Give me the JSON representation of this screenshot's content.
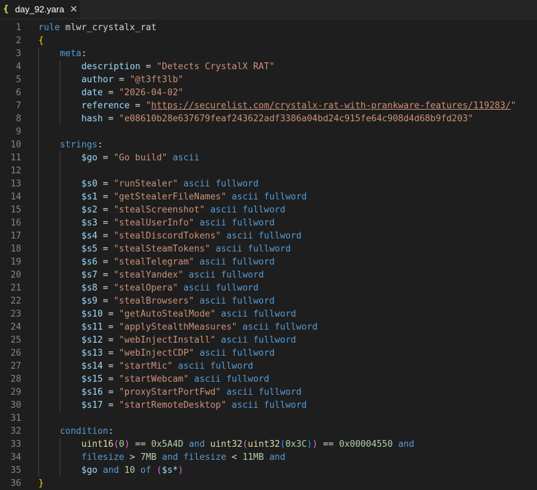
{
  "tab": {
    "icon": "{",
    "title": "day_92.yara",
    "close": "✕"
  },
  "colors": {
    "editor_bg": "#1e1e1e",
    "keyword": "#569cd6",
    "string": "#ce9178",
    "number": "#b5cea8",
    "identifier": "#9cdcfe",
    "function": "#dcdcaa",
    "line_number": "#858585"
  },
  "lines": [
    [
      [
        "kw",
        "rule"
      ],
      [
        "plain",
        " mlwr_crystalx_rat"
      ]
    ],
    [
      [
        "brace",
        "{"
      ]
    ],
    [
      [
        "plain",
        "    "
      ],
      [
        "kw",
        "meta"
      ],
      [
        "plain",
        ":"
      ]
    ],
    [
      [
        "plain",
        "        "
      ],
      [
        "meta",
        "description"
      ],
      [
        "plain",
        " = "
      ],
      [
        "str",
        "\"Detects CrystalX RAT\""
      ]
    ],
    [
      [
        "plain",
        "        "
      ],
      [
        "meta",
        "author"
      ],
      [
        "plain",
        " = "
      ],
      [
        "str",
        "\"@t3ft3lb\""
      ]
    ],
    [
      [
        "plain",
        "        "
      ],
      [
        "meta",
        "date"
      ],
      [
        "plain",
        " = "
      ],
      [
        "str",
        "\"2026-04-02\""
      ]
    ],
    [
      [
        "plain",
        "        "
      ],
      [
        "meta",
        "reference"
      ],
      [
        "plain",
        " = "
      ],
      [
        "str",
        "\""
      ],
      [
        "link",
        "https://securelist.com/crystalx-rat-with-prankware-features/119283/"
      ],
      [
        "str",
        "\""
      ]
    ],
    [
      [
        "plain",
        "        "
      ],
      [
        "meta",
        "hash"
      ],
      [
        "plain",
        " = "
      ],
      [
        "str",
        "\"e08610b28e637679feaf243622adf3386a04bd24c915fe64c908d4d68b9fd203\""
      ]
    ],
    [],
    [
      [
        "plain",
        "    "
      ],
      [
        "kw",
        "strings"
      ],
      [
        "plain",
        ":"
      ]
    ],
    [
      [
        "plain",
        "        "
      ],
      [
        "meta",
        "$go"
      ],
      [
        "plain",
        " = "
      ],
      [
        "str",
        "\"Go build\""
      ],
      [
        "plain",
        " "
      ],
      [
        "kw",
        "ascii"
      ]
    ],
    [],
    [
      [
        "plain",
        "        "
      ],
      [
        "meta",
        "$s0"
      ],
      [
        "plain",
        " = "
      ],
      [
        "str",
        "\"runStealer\""
      ],
      [
        "plain",
        " "
      ],
      [
        "kw",
        "ascii"
      ],
      [
        "plain",
        " "
      ],
      [
        "kw",
        "fullword"
      ]
    ],
    [
      [
        "plain",
        "        "
      ],
      [
        "meta",
        "$s1"
      ],
      [
        "plain",
        " = "
      ],
      [
        "str",
        "\"getStealerFileNames\""
      ],
      [
        "plain",
        " "
      ],
      [
        "kw",
        "ascii"
      ],
      [
        "plain",
        " "
      ],
      [
        "kw",
        "fullword"
      ]
    ],
    [
      [
        "plain",
        "        "
      ],
      [
        "meta",
        "$s2"
      ],
      [
        "plain",
        " = "
      ],
      [
        "str",
        "\"stealScreenshot\""
      ],
      [
        "plain",
        " "
      ],
      [
        "kw",
        "ascii"
      ],
      [
        "plain",
        " "
      ],
      [
        "kw",
        "fullword"
      ]
    ],
    [
      [
        "plain",
        "        "
      ],
      [
        "meta",
        "$s3"
      ],
      [
        "plain",
        " = "
      ],
      [
        "str",
        "\"stealUserInfo\""
      ],
      [
        "plain",
        " "
      ],
      [
        "kw",
        "ascii"
      ],
      [
        "plain",
        " "
      ],
      [
        "kw",
        "fullword"
      ]
    ],
    [
      [
        "plain",
        "        "
      ],
      [
        "meta",
        "$s4"
      ],
      [
        "plain",
        " = "
      ],
      [
        "str",
        "\"stealDiscordTokens\""
      ],
      [
        "plain",
        " "
      ],
      [
        "kw",
        "ascii"
      ],
      [
        "plain",
        " "
      ],
      [
        "kw",
        "fullword"
      ]
    ],
    [
      [
        "plain",
        "        "
      ],
      [
        "meta",
        "$s5"
      ],
      [
        "plain",
        " = "
      ],
      [
        "str",
        "\"stealSteamTokens\""
      ],
      [
        "plain",
        " "
      ],
      [
        "kw",
        "ascii"
      ],
      [
        "plain",
        " "
      ],
      [
        "kw",
        "fullword"
      ]
    ],
    [
      [
        "plain",
        "        "
      ],
      [
        "meta",
        "$s6"
      ],
      [
        "plain",
        " = "
      ],
      [
        "str",
        "\"stealTelegram\""
      ],
      [
        "plain",
        " "
      ],
      [
        "kw",
        "ascii"
      ],
      [
        "plain",
        " "
      ],
      [
        "kw",
        "fullword"
      ]
    ],
    [
      [
        "plain",
        "        "
      ],
      [
        "meta",
        "$s7"
      ],
      [
        "plain",
        " = "
      ],
      [
        "str",
        "\"stealYandex\""
      ],
      [
        "plain",
        " "
      ],
      [
        "kw",
        "ascii"
      ],
      [
        "plain",
        " "
      ],
      [
        "kw",
        "fullword"
      ]
    ],
    [
      [
        "plain",
        "        "
      ],
      [
        "meta",
        "$s8"
      ],
      [
        "plain",
        " = "
      ],
      [
        "str",
        "\"stealOpera\""
      ],
      [
        "plain",
        " "
      ],
      [
        "kw",
        "ascii"
      ],
      [
        "plain",
        " "
      ],
      [
        "kw",
        "fullword"
      ]
    ],
    [
      [
        "plain",
        "        "
      ],
      [
        "meta",
        "$s9"
      ],
      [
        "plain",
        " = "
      ],
      [
        "str",
        "\"stealBrowsers\""
      ],
      [
        "plain",
        " "
      ],
      [
        "kw",
        "ascii"
      ],
      [
        "plain",
        " "
      ],
      [
        "kw",
        "fullword"
      ]
    ],
    [
      [
        "plain",
        "        "
      ],
      [
        "meta",
        "$s10"
      ],
      [
        "plain",
        " = "
      ],
      [
        "str",
        "\"getAutoStealMode\""
      ],
      [
        "plain",
        " "
      ],
      [
        "kw",
        "ascii"
      ],
      [
        "plain",
        " "
      ],
      [
        "kw",
        "fullword"
      ]
    ],
    [
      [
        "plain",
        "        "
      ],
      [
        "meta",
        "$s11"
      ],
      [
        "plain",
        " = "
      ],
      [
        "str",
        "\"applyStealthMeasures\""
      ],
      [
        "plain",
        " "
      ],
      [
        "kw",
        "ascii"
      ],
      [
        "plain",
        " "
      ],
      [
        "kw",
        "fullword"
      ]
    ],
    [
      [
        "plain",
        "        "
      ],
      [
        "meta",
        "$s12"
      ],
      [
        "plain",
        " = "
      ],
      [
        "str",
        "\"webInjectInstall\""
      ],
      [
        "plain",
        " "
      ],
      [
        "kw",
        "ascii"
      ],
      [
        "plain",
        " "
      ],
      [
        "kw",
        "fullword"
      ]
    ],
    [
      [
        "plain",
        "        "
      ],
      [
        "meta",
        "$s13"
      ],
      [
        "plain",
        " = "
      ],
      [
        "str",
        "\"webInjectCDP\""
      ],
      [
        "plain",
        " "
      ],
      [
        "kw",
        "ascii"
      ],
      [
        "plain",
        " "
      ],
      [
        "kw",
        "fullword"
      ]
    ],
    [
      [
        "plain",
        "        "
      ],
      [
        "meta",
        "$s14"
      ],
      [
        "plain",
        " = "
      ],
      [
        "str",
        "\"startMic\""
      ],
      [
        "plain",
        " "
      ],
      [
        "kw",
        "ascii"
      ],
      [
        "plain",
        " "
      ],
      [
        "kw",
        "fullword"
      ]
    ],
    [
      [
        "plain",
        "        "
      ],
      [
        "meta",
        "$s15"
      ],
      [
        "plain",
        " = "
      ],
      [
        "str",
        "\"startWebcam\""
      ],
      [
        "plain",
        " "
      ],
      [
        "kw",
        "ascii"
      ],
      [
        "plain",
        " "
      ],
      [
        "kw",
        "fullword"
      ]
    ],
    [
      [
        "plain",
        "        "
      ],
      [
        "meta",
        "$s16"
      ],
      [
        "plain",
        " = "
      ],
      [
        "str",
        "\"proxyStartPortFwd\""
      ],
      [
        "plain",
        " "
      ],
      [
        "kw",
        "ascii"
      ],
      [
        "plain",
        " "
      ],
      [
        "kw",
        "fullword"
      ]
    ],
    [
      [
        "plain",
        "        "
      ],
      [
        "meta",
        "$s17"
      ],
      [
        "plain",
        " = "
      ],
      [
        "str",
        "\"startRemoteDesktop\""
      ],
      [
        "plain",
        " "
      ],
      [
        "kw",
        "ascii"
      ],
      [
        "plain",
        " "
      ],
      [
        "kw",
        "fullword"
      ]
    ],
    [],
    [
      [
        "plain",
        "    "
      ],
      [
        "kw",
        "condition"
      ],
      [
        "plain",
        ":"
      ]
    ],
    [
      [
        "plain",
        "        "
      ],
      [
        "fn",
        "uint16"
      ],
      [
        "paren",
        "("
      ],
      [
        "num",
        "0"
      ],
      [
        "paren",
        ")"
      ],
      [
        "plain",
        " == "
      ],
      [
        "num",
        "0x5A4D"
      ],
      [
        "plain",
        " "
      ],
      [
        "kw",
        "and"
      ],
      [
        "plain",
        " "
      ],
      [
        "fn",
        "uint32"
      ],
      [
        "paren",
        "("
      ],
      [
        "fn",
        "uint32"
      ],
      [
        "paren2",
        "("
      ],
      [
        "num",
        "0x3C"
      ],
      [
        "paren2",
        ")"
      ],
      [
        "paren",
        ")"
      ],
      [
        "plain",
        " == "
      ],
      [
        "num",
        "0x00004550"
      ],
      [
        "plain",
        " "
      ],
      [
        "kw",
        "and"
      ]
    ],
    [
      [
        "plain",
        "        "
      ],
      [
        "kw",
        "filesize"
      ],
      [
        "plain",
        " > "
      ],
      [
        "num",
        "7MB"
      ],
      [
        "plain",
        " "
      ],
      [
        "kw",
        "and"
      ],
      [
        "plain",
        " "
      ],
      [
        "kw",
        "filesize"
      ],
      [
        "plain",
        " < "
      ],
      [
        "num",
        "11MB"
      ],
      [
        "plain",
        " "
      ],
      [
        "kw",
        "and"
      ]
    ],
    [
      [
        "plain",
        "        "
      ],
      [
        "meta",
        "$go"
      ],
      [
        "plain",
        " "
      ],
      [
        "kw",
        "and"
      ],
      [
        "plain",
        " "
      ],
      [
        "num",
        "10"
      ],
      [
        "plain",
        " "
      ],
      [
        "kw",
        "of"
      ],
      [
        "plain",
        " "
      ],
      [
        "paren",
        "("
      ],
      [
        "meta",
        "$s*"
      ],
      [
        "paren",
        ")"
      ]
    ],
    [
      [
        "brace",
        "}"
      ]
    ]
  ]
}
